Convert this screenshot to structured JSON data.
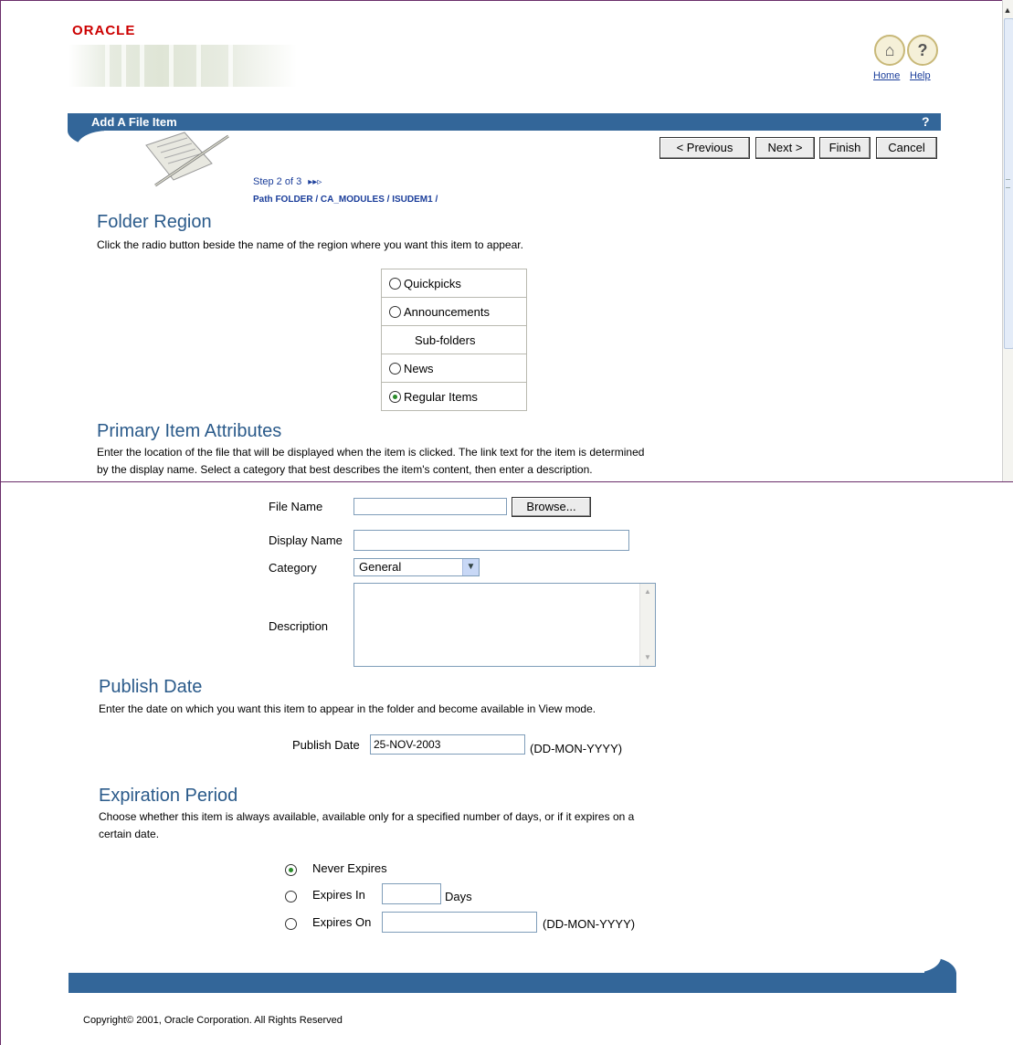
{
  "header": {
    "logo_text": "ORACLE",
    "home_label": "Home",
    "help_label": "Help",
    "home_icon": "home-icon",
    "help_icon": "question-icon"
  },
  "title_bar": {
    "title": "Add A File Item",
    "help_glyph": "?"
  },
  "nav": {
    "previous": "< Previous",
    "next": "Next >",
    "finish": "Finish",
    "cancel": "Cancel"
  },
  "step": {
    "text": "Step 2 of 3",
    "arrows_glyph": "▸▸▹",
    "path": "Path FOLDER / CA_MODULES / ISUDEM1 /"
  },
  "folder_region": {
    "heading": "Folder Region",
    "description": "Click the radio button beside the name of the region where you want this item to appear.",
    "options": [
      {
        "label": "Quickpicks",
        "radio": true,
        "checked": false
      },
      {
        "label": "Announcements",
        "radio": true,
        "checked": false
      },
      {
        "label": "Sub-folders",
        "radio": false,
        "checked": false
      },
      {
        "label": "News",
        "radio": true,
        "checked": false
      },
      {
        "label": "Regular Items",
        "radio": true,
        "checked": true
      }
    ]
  },
  "primary": {
    "heading": "Primary Item Attributes",
    "description_line1": "Enter the location of the file that will be displayed when the item is clicked. The link text for the item is determined",
    "description_line2": "by the display name. Select a category that best describes the item's content, then enter a description.",
    "file_name_label": "File Name",
    "file_name_value": "",
    "browse_label": "Browse...",
    "display_name_label": "Display Name",
    "display_name_value": "",
    "category_label": "Category",
    "category_value": "General",
    "description_label": "Description",
    "description_value": ""
  },
  "publish": {
    "heading": "Publish Date",
    "description": "Enter the date on which you want this item to appear in the folder and become available in View mode.",
    "label": "Publish Date",
    "value": "25-NOV-2003",
    "format": "(DD-MON-YYYY)"
  },
  "expiration": {
    "heading": "Expiration Period",
    "description_line1": "Choose whether this item is always available, available only for a specified number of days, or if it expires on a",
    "description_line2": "certain date.",
    "never_label": "Never Expires",
    "expires_in_label": "Expires In",
    "days_label": "Days",
    "days_value": "",
    "expires_on_label": "Expires On",
    "expires_on_value": "",
    "format": "(DD-MON-YYYY)",
    "selected": "Never Expires"
  },
  "footer": {
    "copyright": "Copyright© 2001, Oracle Corporation. All Rights Reserved"
  },
  "colors": {
    "title_bar": "#336699",
    "heading": "#2a5a8a",
    "link": "#1a3d9a",
    "logo": "#cc0000"
  }
}
